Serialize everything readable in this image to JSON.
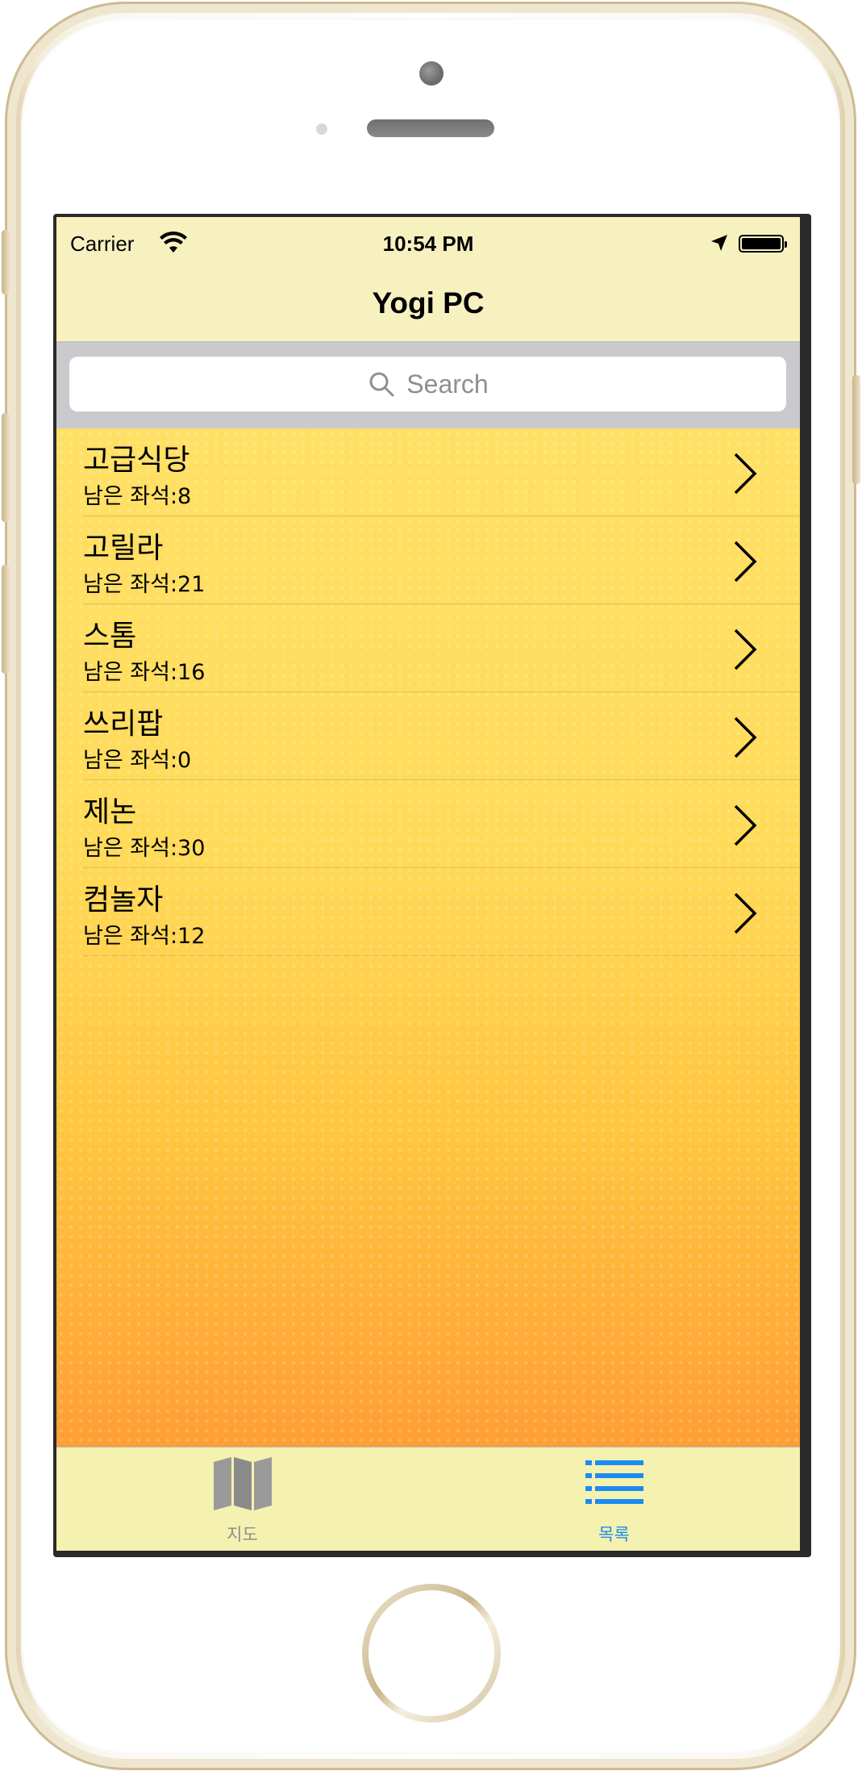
{
  "status_bar": {
    "carrier": "Carrier",
    "time": "10:54 PM"
  },
  "nav": {
    "title": "Yogi PC"
  },
  "search": {
    "placeholder": "Search",
    "value": ""
  },
  "list": {
    "items": [
      {
        "name": "고급식당",
        "seats": "남은 좌석:8"
      },
      {
        "name": "고릴라",
        "seats": "남은 좌석:21"
      },
      {
        "name": "스톰",
        "seats": "남은 좌석:16"
      },
      {
        "name": "쓰리팝",
        "seats": "남은 좌석:0"
      },
      {
        "name": "제논",
        "seats": "남은 좌석:30"
      },
      {
        "name": "컴놀자",
        "seats": "남은 좌석:12"
      }
    ]
  },
  "tabbar": {
    "tabs": [
      {
        "label": "지도",
        "icon": "map-icon",
        "selected": false
      },
      {
        "label": "목록",
        "icon": "list-icon",
        "selected": true
      }
    ],
    "active_color": "#1a8cf0",
    "inactive_color": "#8e8e8e"
  },
  "colors": {
    "nav_background": "#f7f1c0",
    "list_gradient_top": "#ffe066",
    "list_gradient_bottom": "#ff9e34"
  }
}
